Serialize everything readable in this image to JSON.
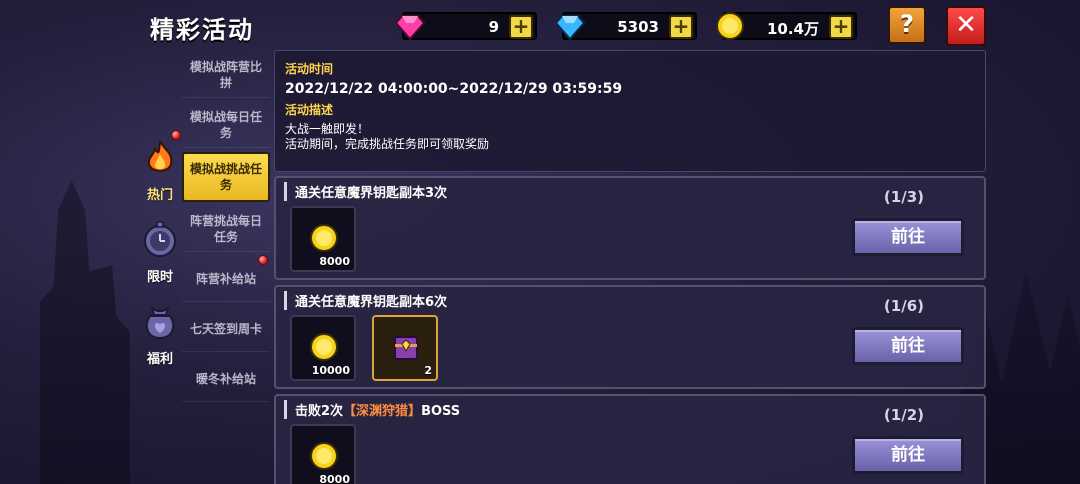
{
  "title": "精彩活动",
  "currencies": {
    "gem": "9",
    "diamond": "5303",
    "gold": "10.4万"
  },
  "buttons": {
    "plus": "+",
    "help": "?",
    "close": "✕"
  },
  "categories": [
    {
      "label": "热门",
      "icon": "fire-icon"
    },
    {
      "label": "限时",
      "icon": "clock-icon"
    },
    {
      "label": "福利",
      "icon": "gift-bag-icon"
    }
  ],
  "sub_items": [
    {
      "label": "模拟战阵营比拼"
    },
    {
      "label": "模拟战每日任务"
    },
    {
      "label": "模拟战挑战任务"
    },
    {
      "label": "阵营挑战每日任务"
    },
    {
      "label": "阵营补给站"
    },
    {
      "label": "七天签到周卡"
    },
    {
      "label": "暖冬补给站"
    }
  ],
  "info": {
    "time_heading": "活动时间",
    "time_value": "2022/12/22 04:00:00~2022/12/29 03:59:59",
    "desc_heading": "活动描述",
    "desc_line1": "大战一触即发！",
    "desc_line2": "活动期间，完成挑战任务即可领取奖励"
  },
  "tasks": [
    {
      "name": "通关任意魔界钥匙副本3次",
      "progress": "(1/3)",
      "button": "前往",
      "rewards": [
        {
          "icon": "gold-coin-icon",
          "qty": "8000"
        }
      ]
    },
    {
      "name": "通关任意魔界钥匙副本6次",
      "progress": "(1/6)",
      "button": "前往",
      "rewards": [
        {
          "icon": "gold-coin-icon",
          "qty": "10000"
        },
        {
          "icon": "treasure-chest-icon",
          "qty": "2"
        }
      ]
    },
    {
      "name_prefix": "击败2次",
      "name_highlight": "【深渊狩猎】",
      "name_suffix": "BOSS",
      "progress": "(1/2)",
      "button": "前往",
      "rewards": [
        {
          "icon": "gold-coin-icon",
          "qty": "8000"
        }
      ]
    }
  ],
  "colors": {
    "accent_yellow": "#fcdc4f",
    "highlight_orange": "#ff8b3d",
    "button_purple": "#7c74bb",
    "close_red": "#e02a2a"
  }
}
